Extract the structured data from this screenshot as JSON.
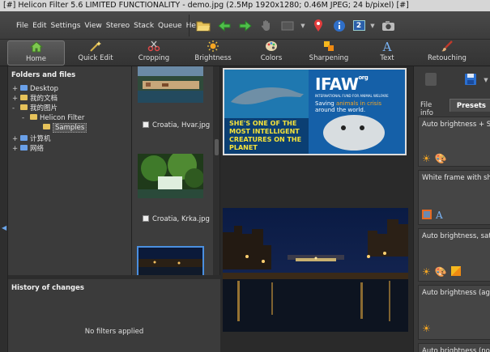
{
  "window": {
    "title": "[#] Helicon Filter 5.6 LIMITED FUNCTIONALITY - demo.jpg (2.5Mp 1920x1280; 0.46M JPEG; 24 b/pixel) [#]"
  },
  "menu": [
    "File",
    "Edit",
    "Settings",
    "View",
    "Stereo",
    "Stack",
    "Queue",
    "Help"
  ],
  "toolbar": {
    "icons": [
      "open-folder-icon",
      "back-arrow-icon",
      "forward-arrow-icon",
      "hand-icon",
      "image-icon",
      "location-pin-icon",
      "info-icon",
      "count-icon",
      "camera-icon"
    ],
    "count_value": "2"
  },
  "tabs": [
    {
      "label": "Home",
      "icon": "home-icon",
      "active": true
    },
    {
      "label": "Quick Edit",
      "icon": "magic-wand-icon"
    },
    {
      "label": "Cropping",
      "icon": "scissors-icon"
    },
    {
      "label": "Brightness",
      "icon": "sun-icon"
    },
    {
      "label": "Colors",
      "icon": "palette-icon"
    },
    {
      "label": "Sharpening",
      "icon": "sharpen-icon"
    },
    {
      "label": "Text",
      "icon": "text-icon"
    },
    {
      "label": "Retouching",
      "icon": "brush-icon"
    }
  ],
  "folders": {
    "title": "Folders and files",
    "items": [
      {
        "label": "Desktop",
        "expander": "+",
        "depth": 0
      },
      {
        "label": "我的文档",
        "expander": "+",
        "depth": 0
      },
      {
        "label": "我的图片",
        "expander": "-",
        "depth": 0
      },
      {
        "label": "Helicon Filter",
        "expander": "-",
        "depth": 1
      },
      {
        "label": "Samples",
        "expander": "",
        "depth": 2,
        "selected": true
      },
      {
        "label": "计算机",
        "expander": "+",
        "depth": 0
      },
      {
        "label": "网络",
        "expander": "+",
        "depth": 0
      }
    ]
  },
  "thumbnails": [
    {
      "label": "Croatia, Hvar.jpg"
    },
    {
      "label": "Croatia, Krka.jpg"
    }
  ],
  "history": {
    "title": "History of changes",
    "empty_text": "No filters applied"
  },
  "preview": {
    "ad_headline": "SHE'S ONE OF THE MOST INTELLIGENT CREATURES ON THE PLANET",
    "ad_brand": "IFAW",
    "ad_brand_sub": "org",
    "ad_brand_caption": "INTERNATIONAL FUND FOR ANIMAL WELFARE",
    "ad_tagline_1": "Saving",
    "ad_tagline_highlight": "animals in crisis",
    "ad_tagline_2": "around the world."
  },
  "right_panel": {
    "tabs": [
      "File info",
      "Presets"
    ],
    "active_tab": "Presets",
    "presets": [
      "Auto brightness + Sepia",
      "White frame with shoot",
      "Auto brightness, satura",
      "Auto brightness (aggre",
      "Auto brightness (norm"
    ]
  },
  "colors": {
    "accent": "#4a8fe0",
    "panel": "#3b3b3b",
    "selection": "#6aa4e8"
  }
}
